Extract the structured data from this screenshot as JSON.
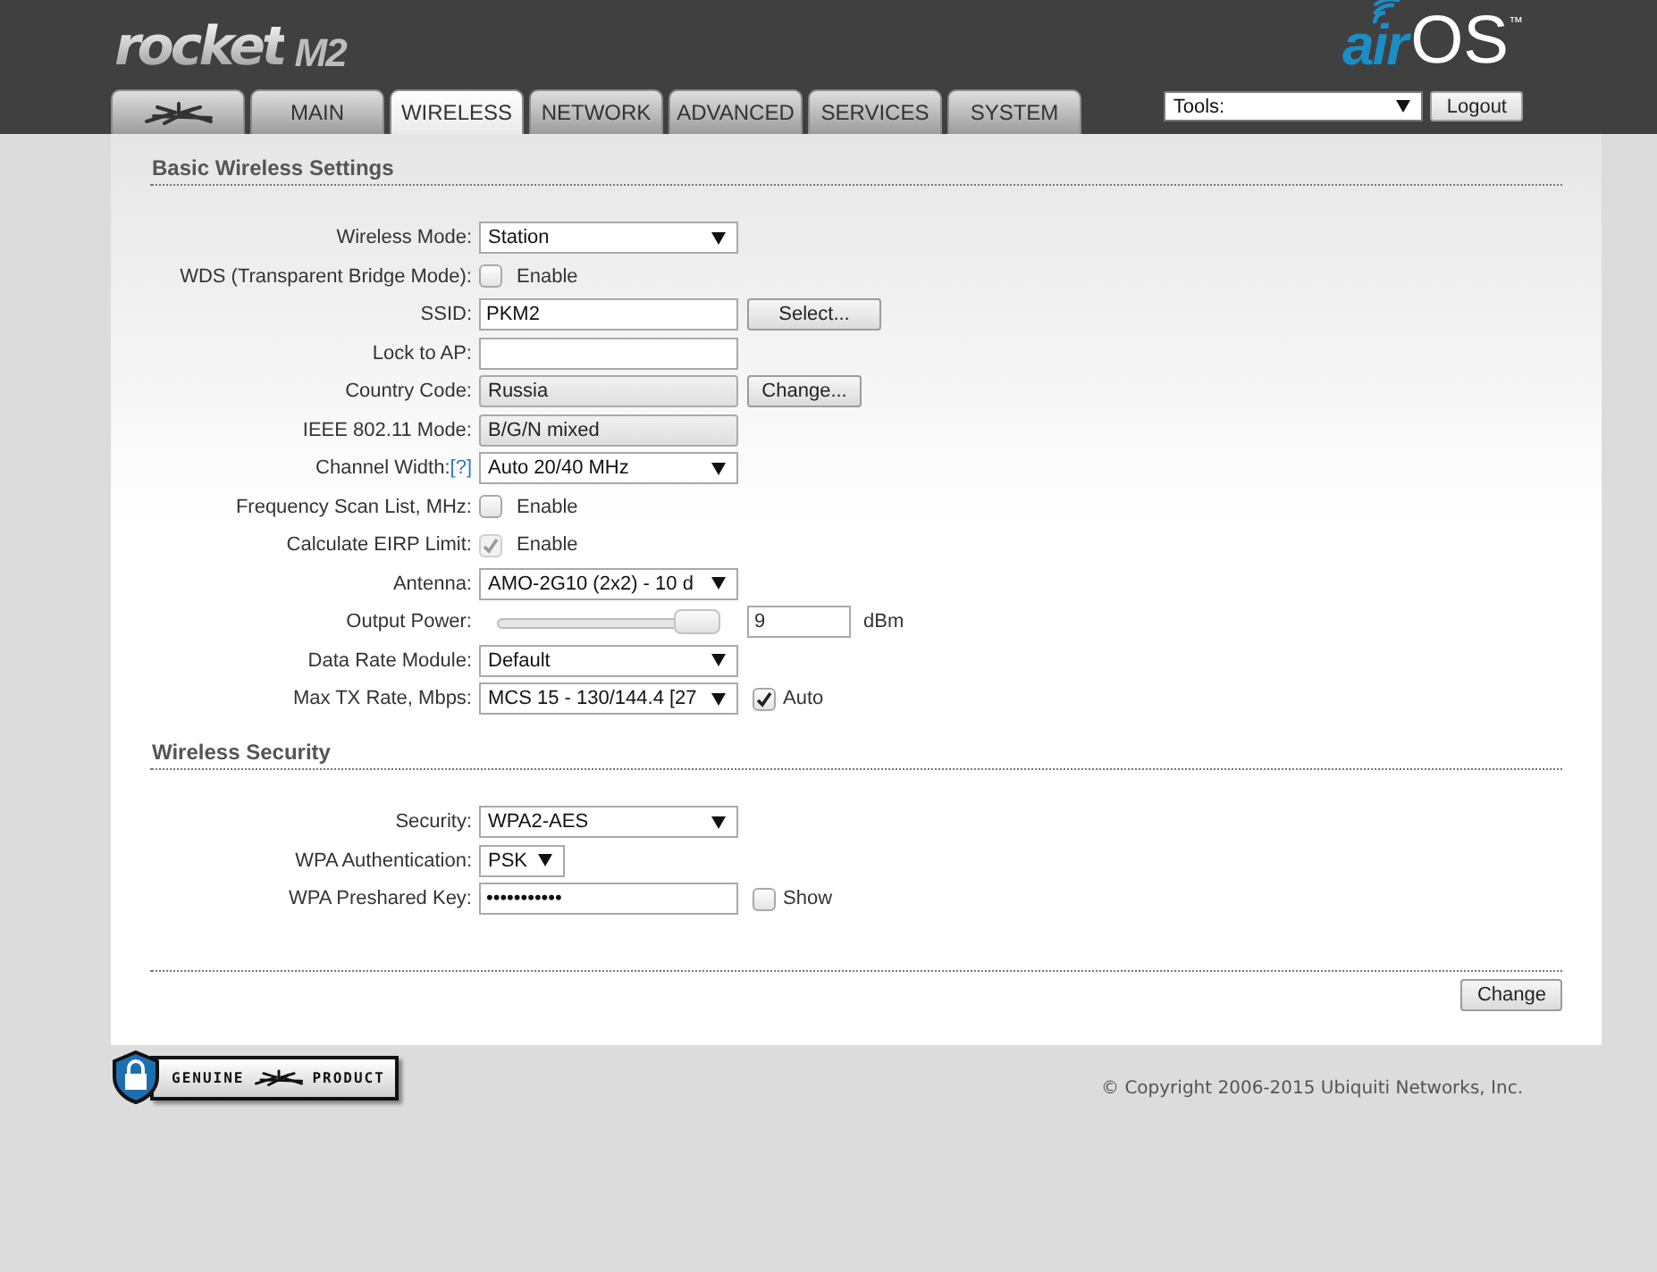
{
  "header": {
    "product_logo": {
      "name": "rocket",
      "model": "M2"
    },
    "os_logo": {
      "prefix": "air",
      "name": "OS",
      "mark": "™"
    },
    "tools": {
      "value": "Tools:"
    },
    "logout": "Logout"
  },
  "tabs": [
    {
      "kind": "logo",
      "selected": false
    },
    {
      "kind": "text",
      "label": "MAIN",
      "selected": false
    },
    {
      "kind": "text",
      "label": "WIRELESS",
      "selected": true
    },
    {
      "kind": "text",
      "label": "NETWORK",
      "selected": false
    },
    {
      "kind": "text",
      "label": "ADVANCED",
      "selected": false
    },
    {
      "kind": "text",
      "label": "SERVICES",
      "selected": false
    },
    {
      "kind": "text",
      "label": "SYSTEM",
      "selected": false
    }
  ],
  "sections": [
    {
      "title": "Basic Wireless Settings",
      "rows": [
        {
          "label": "Wireless Mode:",
          "kind": "select",
          "value": "Station"
        },
        {
          "label": "WDS (Transparent Bridge Mode):",
          "kind": "checkbox",
          "checked": false,
          "disabled": false,
          "text": "Enable"
        },
        {
          "label": "SSID:",
          "kind": "input",
          "value": "PKM2",
          "button": "Select..."
        },
        {
          "label": "Lock to AP:",
          "kind": "input"
        },
        {
          "label": "Country Code:",
          "kind": "readonly",
          "value": "Russia",
          "button": "Change..."
        },
        {
          "label": "IEEE 802.11 Mode:",
          "kind": "readonly",
          "value": "B/G/N mixed"
        },
        {
          "label": "Channel Width:",
          "help": "[?]",
          "kind": "select",
          "value": "Auto 20/40 MHz"
        },
        {
          "label": "Frequency Scan List, MHz:",
          "kind": "checkbox",
          "checked": false,
          "disabled": false,
          "text": "Enable"
        },
        {
          "label": "Calculate EIRP Limit:",
          "kind": "checkbox",
          "checked": true,
          "disabled": true,
          "text": "Enable"
        },
        {
          "label": "Antenna:",
          "kind": "select",
          "value": "AMO-2G10 (2x2) - 10 d"
        },
        {
          "label": "Output Power:",
          "kind": "slider",
          "level": 1,
          "value": "9",
          "unit": "dBm"
        },
        {
          "label": "Data Rate Module:",
          "kind": "select",
          "value": "Default"
        },
        {
          "label": "Max TX Rate, Mbps:",
          "kind": "select",
          "value": "MCS 15 - 130/144.4 [27",
          "option": {
            "checked": true,
            "text": "Auto"
          }
        }
      ]
    },
    {
      "title": "Wireless Security",
      "rows": [
        {
          "label": "Security:",
          "kind": "select",
          "value": "WPA2-AES"
        },
        {
          "label": "WPA Authentication:",
          "kind": "select",
          "value": "PSK",
          "compact": true
        },
        {
          "label": "WPA Preshared Key:",
          "kind": "input",
          "value": "•••••••••••",
          "option": {
            "checked": false,
            "text": "Show"
          }
        }
      ]
    }
  ],
  "apply_button": "Change",
  "footer": {
    "badge": {
      "left": "GENUINE",
      "right": "PRODUCT"
    },
    "copyright": "© Copyright 2006-2015 Ubiquiti Networks, Inc."
  }
}
